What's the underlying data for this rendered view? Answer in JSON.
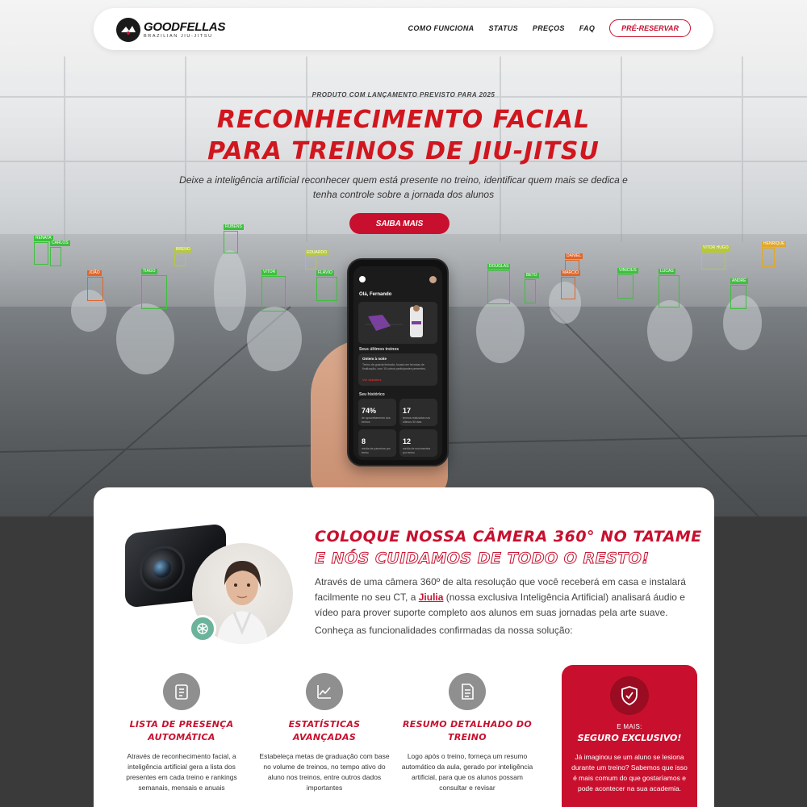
{
  "nav": {
    "logo_name": "GOODFELLAS",
    "logo_sub": "BRAZILIAN JIU-JITSU",
    "links": [
      "COMO FUNCIONA",
      "STATUS",
      "PREÇOS",
      "FAQ"
    ],
    "cta": "PRÉ-RESERVAR"
  },
  "hero": {
    "kicker": "PRODUTO COM LANÇAMENTO PREVISTO PARA 2025",
    "title_line1": "RECONHECIMENTO FACIAL",
    "title_line2": "PARA TREINOS DE JIU-JITSU",
    "lead": "Deixe a inteligência artificial reconhecer quem está presente no treino, identificar quem mais se dedica e tenha controle sobre a jornada dos alunos",
    "button": "SAIBA MAIS",
    "detections": [
      {
        "label": "RENATA",
        "color": "#3fbf3f"
      },
      {
        "label": "CARLOS",
        "color": "#3fbf3f"
      },
      {
        "label": "JOÃO",
        "color": "#e0662a"
      },
      {
        "label": "TIAGO",
        "color": "#3fbf3f"
      },
      {
        "label": "RUBENS",
        "color": "#3fbf3f"
      },
      {
        "label": "BRENO",
        "color": "#b7c93a"
      },
      {
        "label": "EDUARDO",
        "color": "#b7c93a"
      },
      {
        "label": "VITOR",
        "color": "#3fbf3f"
      },
      {
        "label": "FLÁVIO",
        "color": "#3fbf3f"
      },
      {
        "label": "DOUGLAS",
        "color": "#3fbf3f"
      },
      {
        "label": "BETO",
        "color": "#3fbf3f"
      },
      {
        "label": "DANIEL",
        "color": "#e0662a"
      },
      {
        "label": "MARCIO",
        "color": "#e0662a"
      },
      {
        "label": "VINICIUS",
        "color": "#3fbf3f"
      },
      {
        "label": "LUCAS",
        "color": "#3fbf3f"
      },
      {
        "label": "VITOR HUGO",
        "color": "#b7c93a"
      },
      {
        "label": "ANDRÉ",
        "color": "#3fbf3f"
      },
      {
        "label": "HENRIQUE",
        "color": "#e0a82a"
      }
    ]
  },
  "app": {
    "greeting": "Olá, Fernando",
    "recent_title": "Seus últimos treinos",
    "recent_card_title": "Ontem à noite",
    "recent_card_text": "Treino de guarda fechada, focado em técnicas de finalização, com 15 outros participantes presentes.",
    "recent_card_link": "Ver detalhes",
    "history_title": "Seu histórico",
    "stats": [
      {
        "value": "74%",
        "label": "de aproveitamento dos treinos"
      },
      {
        "value": "17",
        "label": "treinos realizados nos últimos 30 dias"
      },
      {
        "value": "8",
        "label": "média de parceiros por treino"
      },
      {
        "value": "12",
        "label": "média de movimentos por treino"
      }
    ]
  },
  "section": {
    "title_line1": "COLOQUE NOSSA CÂMERA 360° NO TATAME",
    "title_line2": "E NÓS CUIDAMOS DE TODO O RESTO!",
    "body_before": "Através de uma câmera 360º de alta resolução que você receberá em casa e instalará facilmente no seu CT, a ",
    "body_link": "Jiulia",
    "body_after": " (nossa exclusiva Inteligência Artificial) analisará áudio e vídeo para prover suporte completo aos alunos em suas jornadas pela arte suave.",
    "note": "Conheça as funcionalidades confirmadas da nossa solução:"
  },
  "features": [
    {
      "icon": "clipboard-icon",
      "title": "LISTA DE PRESENÇA AUTOMÁTICA",
      "desc": "Através de reconhecimento facial, a inteligência artificial gera a lista dos presentes em cada treino e rankings semanais, mensais e anuais"
    },
    {
      "icon": "chart-icon",
      "title": "ESTATÍSTICAS AVANÇADAS",
      "desc": "Estabeleça metas de graduação com base no volume de treinos, no tempo ativo do aluno nos treinos, entre outros dados importantes"
    },
    {
      "icon": "document-icon",
      "title": "RESUMO DETALHADO DO TREINO",
      "desc": "Logo após o treino, forneça um resumo automático da aula, gerado por inteligência artificial, para que os alunos possam consultar e revisar"
    }
  ],
  "exclusive": {
    "icon": "shield-check-icon",
    "subtitle": "E MAIS:",
    "title": "SEGURO EXCLUSIVO!",
    "desc": "Já imaginou se um aluno se lesiona durante um treino? Sabemos que isso é mais comum do que gostaríamos e pode acontecer na sua academia."
  },
  "colors": {
    "accent": "#c8102e",
    "dark": "#3a3a3a",
    "icon_gray": "#8f8f8f"
  }
}
